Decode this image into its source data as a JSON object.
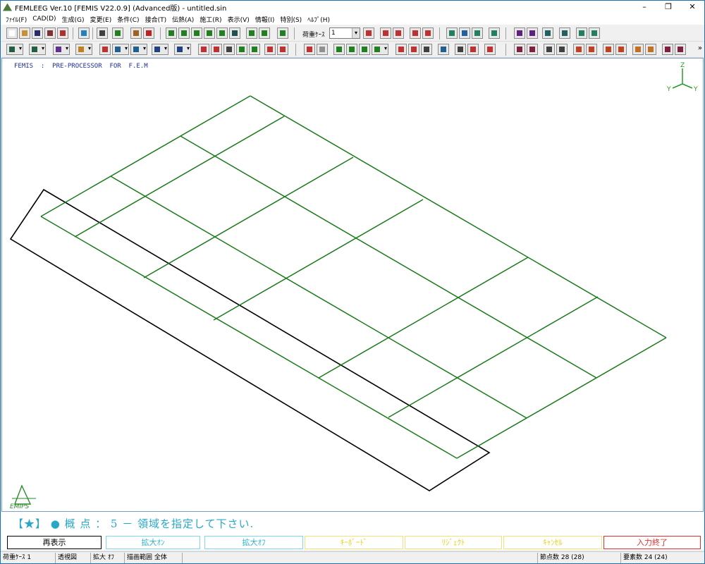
{
  "window": {
    "title": "FEMLEEG Ver.10 [FEMIS V22.0.9] (Advanced版) - untitled.sin",
    "minimize": "–",
    "maximize": "❐",
    "close": "✕"
  },
  "menu": [
    "ﾌｧｲﾙ(F)",
    "CAD(D)",
    "生成(G)",
    "変更(E)",
    "条件(C)",
    "接合(T)",
    "伝熱(A)",
    "施工(R)",
    "表示(V)",
    "情報(I)",
    "特別(S)",
    "ﾍﾙﾌﾟ(H)"
  ],
  "toolbar": {
    "load_case_label": "荷重ｹｰｽ",
    "load_case_value": "1",
    "more": "»"
  },
  "canvas": {
    "header": "FEMIS  :  PRE-PROCESSOR  FOR  F.E.M",
    "axis_z": "Z",
    "axis_y1": "Y",
    "axis_y2": "Y",
    "logo_text": "EMIPS",
    "mesh_color": "#1a7a1a",
    "boundary_color": "#000000"
  },
  "prompt": {
    "text": "【★】 ● 概 点 ： 5 － 領域を指定して下さい."
  },
  "commands": [
    {
      "label": "再表示",
      "color": "#000000",
      "border": "#000000"
    },
    {
      "label": "拡大ｵﾝ",
      "color": "#28b4d0",
      "border": "#7fd8ee"
    },
    {
      "label": "拡大ｵﾌ",
      "color": "#28b4d0",
      "border": "#7fd8ee"
    },
    {
      "label": "ｷｰﾎﾞｰﾄﾞ",
      "color": "#e8d020",
      "border": "#f2e27a"
    },
    {
      "label": "ﾘｼﾞｪｸﾄ",
      "color": "#e8d020",
      "border": "#f2e27a"
    },
    {
      "label": "ｷｬﾝｾﾙ",
      "color": "#e8d020",
      "border": "#f2e27a"
    },
    {
      "label": "入力終了",
      "color": "#e03030",
      "border": "#e03030"
    }
  ],
  "status": {
    "load_case": "荷重ｹｰｽ 1",
    "view": "透視図",
    "zoom": "拡大 ｵﾌ",
    "draw_range": "描画範囲 全体",
    "nodes": "節点数 28 (28)",
    "elements": "要素数 24 (24)"
  }
}
